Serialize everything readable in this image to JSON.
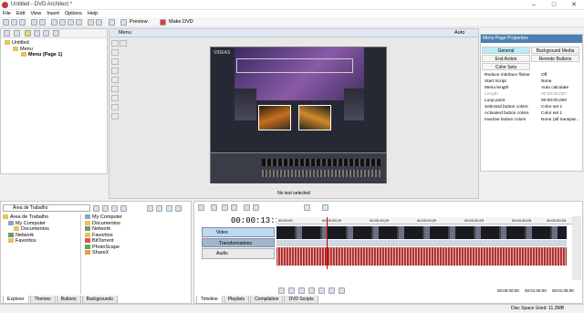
{
  "window": {
    "title": "Untitled - DVD Architect *",
    "min": "–",
    "max": "□",
    "close": "✕"
  },
  "menu": [
    "File",
    "Edit",
    "View",
    "Insert",
    "Options",
    "Help"
  ],
  "toolbar": {
    "preview_label": "Preview",
    "make_dvd_label": "Make DVD"
  },
  "project_tree": {
    "root": "Untitled",
    "menu": "Menu",
    "page": "Menu (Page 1)"
  },
  "menu_panel": {
    "title": "Menu",
    "status": "No text selected",
    "zoom": "Auto",
    "page_heading": "VIDEAS"
  },
  "properties": {
    "title": "Menu Page Properties",
    "tabs": [
      "General",
      "Background Media",
      "End Action",
      "Remote Buttons",
      "Color Sets"
    ],
    "rows": [
      {
        "key": "Reduce interlace flicker",
        "value": "Off",
        "dim": false
      },
      {
        "key": "Start Script",
        "value": "None",
        "dim": false
      },
      {
        "key": "Menu length",
        "value": "Auto calculate",
        "dim": false
      },
      {
        "key": "Length",
        "value": "00:00:05,067",
        "dim": true
      },
      {
        "key": "Loop point",
        "value": "00:00:00,000",
        "dim": false
      },
      {
        "key": "Selected button colors",
        "value": "Color set 1",
        "dim": false
      },
      {
        "key": "Activated button colors",
        "value": "Color set 1",
        "dim": false
      },
      {
        "key": "Inactive button colors",
        "value": "None (all transpar...",
        "dim": false
      }
    ]
  },
  "explorer": {
    "location": "Área de Trabalho",
    "tree": [
      "Área de Trabalho",
      "My Computer",
      "Documentos",
      "Network",
      "Favoritos"
    ],
    "files": [
      "My Computer",
      "Documentos",
      "Network",
      "Favoritos",
      "BitTorrent",
      "PhotoScape",
      "ShareX"
    ],
    "tabs": [
      "Explorer",
      "Themes",
      "Buttons",
      "Backgrounds"
    ]
  },
  "timeline": {
    "time": "00:00:13:17",
    "ruler": [
      "00:00:00",
      "00:00:09;29",
      "00:00:19;29",
      "00:00:29;29",
      "00:00:39;29",
      "00:00:49;28",
      "00:00:59;28"
    ],
    "tracks": {
      "video": "Video",
      "transitions": "Transformations",
      "audio": "Audio"
    },
    "tabs": [
      "Timeline",
      "Playlists",
      "Compilation",
      "DVD Scripts"
    ],
    "t1": "00:00:00:00",
    "t2": "00:01:05:00",
    "t3": "00:01:05:00"
  },
  "status": {
    "disc_space": "Disc Space Used: 11,3MB"
  }
}
